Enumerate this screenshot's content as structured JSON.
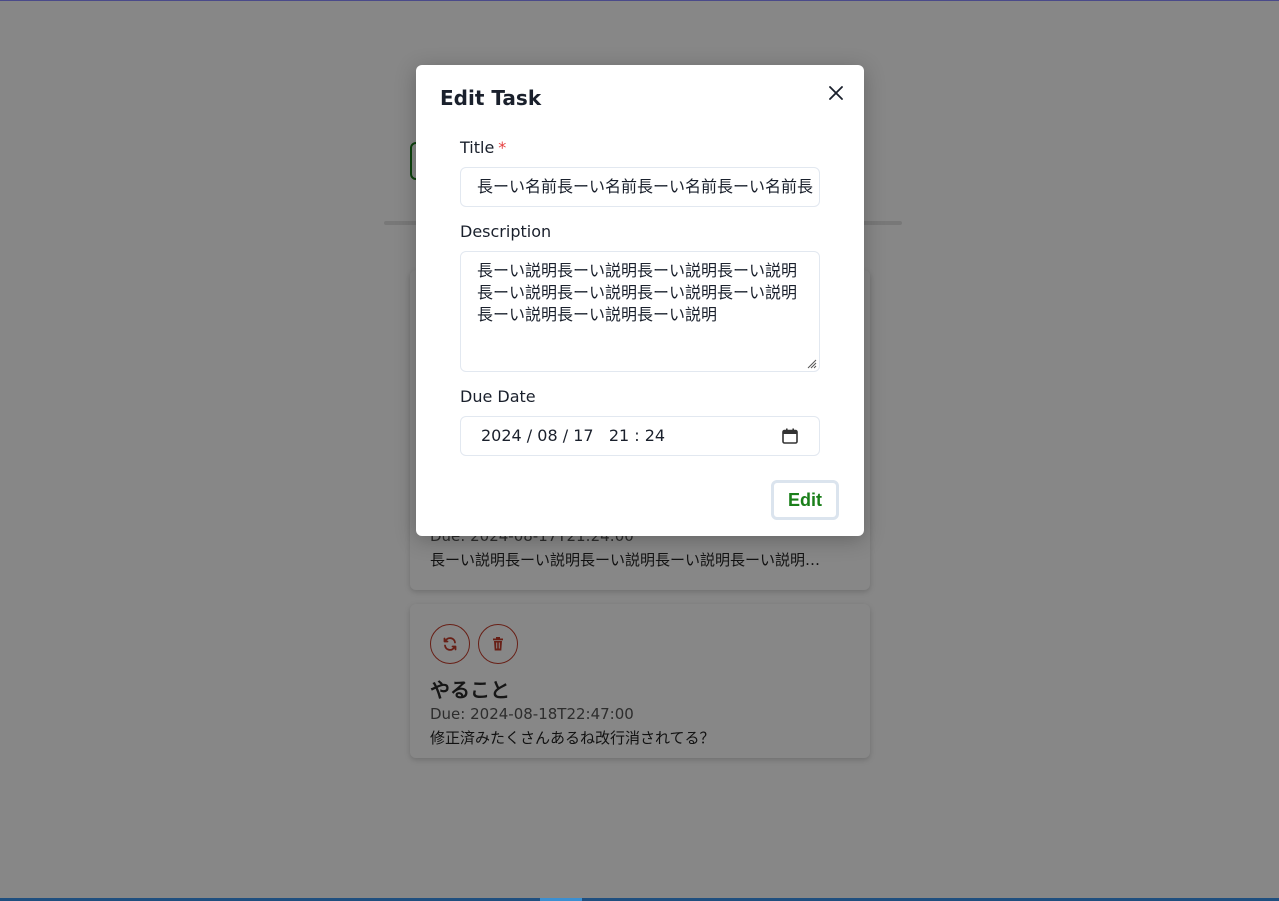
{
  "background": {
    "tasks": [
      {
        "title": "",
        "due": "Due: 2024-08-17T21:24:00",
        "description": "長ーい説明長ーい説明長ーい説明長ーい説明長ーい説明…"
      },
      {
        "title": "やること",
        "due": "Due: 2024-08-18T22:47:00",
        "description": "修正済みたくさんあるね改行消されてる？"
      }
    ],
    "icons": {
      "update": "refresh-icon",
      "delete": "trash-icon"
    },
    "colors": {
      "danger": "#c43c2a",
      "success": "#1a7f1a"
    }
  },
  "modal": {
    "title": "Edit Task",
    "close_icon": "close-icon",
    "fields": {
      "title": {
        "label": "Title",
        "required_mark": "*",
        "value": "長ーい名前長ーい名前長ーい名前長ーい名前長"
      },
      "description": {
        "label": "Description",
        "value": "長ーい説明長ーい説明長ーい説明長ーい説明長ーい説明長ーい説明長ーい説明長ーい説明長ーい説明長ーい説明長ーい説明"
      },
      "due_date": {
        "label": "Due Date",
        "value": "2024 / 08 / 17   21 : 24",
        "icon": "calendar-icon"
      }
    },
    "submit_label": "Edit"
  }
}
